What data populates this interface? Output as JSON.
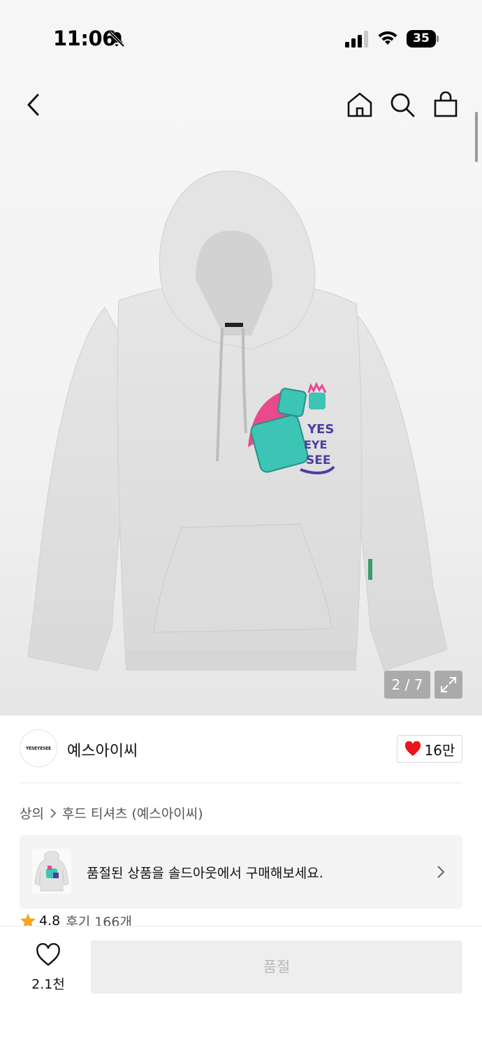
{
  "status_bar": {
    "time": "11:06",
    "battery": "35"
  },
  "gallery": {
    "pager": "2 / 7",
    "print_text": "YES EYE SEE"
  },
  "brand": {
    "logo_text": "YESEYESEE",
    "name": "예스아이씨",
    "likes": "16만"
  },
  "breadcrumb": {
    "items": [
      "상의",
      "후드 티셔츠 (예스아이씨)"
    ]
  },
  "banner": {
    "text": "품절된 상품을 솔드아웃에서 구매해보세요."
  },
  "rating": {
    "score": "4.8",
    "reviews": "후기 166개"
  },
  "bottom": {
    "wish_count": "2.1천",
    "buy_label": "품절"
  },
  "colors": {
    "accent_heart": "#e8171d",
    "star": "#f5a623",
    "print_teal": "#3cc4b4",
    "print_purple": "#4b3fa0",
    "print_pink": "#e84a8a"
  }
}
